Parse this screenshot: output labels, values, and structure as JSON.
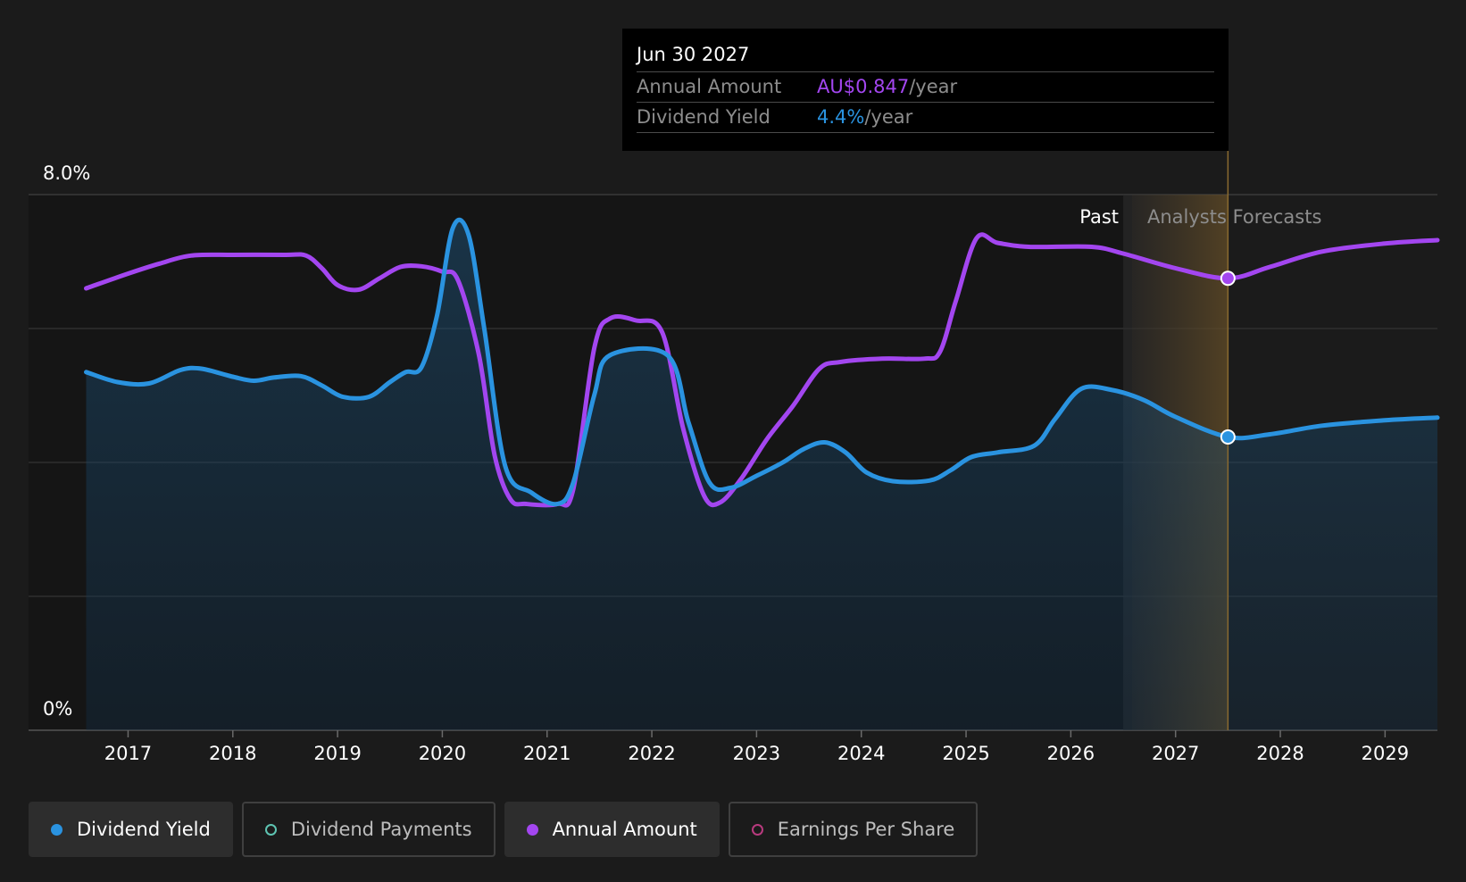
{
  "chart_data": {
    "type": "line",
    "y_axis": {
      "top_label": "8.0%",
      "bottom_label": "0%",
      "ylim": [
        0,
        8
      ]
    },
    "x_ticks": [
      "2017",
      "2018",
      "2019",
      "2020",
      "2021",
      "2022",
      "2023",
      "2024",
      "2025",
      "2026",
      "2027",
      "2028",
      "2029"
    ],
    "xlim": [
      2016.05,
      2029.5
    ],
    "past_label": "Past",
    "forecast_label": "Analysts Forecasts",
    "past_region_start": 2026.5,
    "forecast_divider": 2027.5,
    "series": [
      {
        "name": "Annual Amount",
        "color": "#a346f0",
        "points": [
          [
            2016.6,
            6.6
          ],
          [
            2017.0,
            6.82
          ],
          [
            2017.3,
            6.97
          ],
          [
            2017.6,
            7.09
          ],
          [
            2018.0,
            7.1
          ],
          [
            2018.5,
            7.1
          ],
          [
            2018.7,
            7.09
          ],
          [
            2018.85,
            6.9
          ],
          [
            2019.0,
            6.65
          ],
          [
            2019.2,
            6.58
          ],
          [
            2019.4,
            6.75
          ],
          [
            2019.6,
            6.92
          ],
          [
            2019.8,
            6.93
          ],
          [
            2020.0,
            6.85
          ],
          [
            2020.15,
            6.72
          ],
          [
            2020.35,
            5.6
          ],
          [
            2020.5,
            4.1
          ],
          [
            2020.65,
            3.45
          ],
          [
            2020.8,
            3.38
          ],
          [
            2021.1,
            3.38
          ],
          [
            2021.25,
            3.6
          ],
          [
            2021.45,
            5.7
          ],
          [
            2021.6,
            6.15
          ],
          [
            2021.85,
            6.12
          ],
          [
            2022.1,
            5.94
          ],
          [
            2022.3,
            4.5
          ],
          [
            2022.5,
            3.5
          ],
          [
            2022.65,
            3.4
          ],
          [
            2022.85,
            3.75
          ],
          [
            2023.1,
            4.35
          ],
          [
            2023.35,
            4.85
          ],
          [
            2023.6,
            5.4
          ],
          [
            2023.8,
            5.5
          ],
          [
            2024.2,
            5.55
          ],
          [
            2024.6,
            5.55
          ],
          [
            2024.75,
            5.65
          ],
          [
            2024.9,
            6.4
          ],
          [
            2025.1,
            7.35
          ],
          [
            2025.3,
            7.28
          ],
          [
            2025.6,
            7.22
          ],
          [
            2026.2,
            7.22
          ],
          [
            2026.5,
            7.12
          ],
          [
            2027.0,
            6.9
          ],
          [
            2027.5,
            6.75
          ],
          [
            2027.9,
            6.92
          ],
          [
            2028.4,
            7.15
          ],
          [
            2029.0,
            7.27
          ],
          [
            2029.5,
            7.32
          ]
        ]
      },
      {
        "name": "Dividend Yield",
        "color": "#2a93e0",
        "points": [
          [
            2016.6,
            5.35
          ],
          [
            2016.9,
            5.2
          ],
          [
            2017.2,
            5.18
          ],
          [
            2017.5,
            5.38
          ],
          [
            2017.7,
            5.4
          ],
          [
            2018.0,
            5.28
          ],
          [
            2018.2,
            5.22
          ],
          [
            2018.4,
            5.27
          ],
          [
            2018.65,
            5.29
          ],
          [
            2018.85,
            5.15
          ],
          [
            2019.05,
            4.98
          ],
          [
            2019.3,
            4.98
          ],
          [
            2019.5,
            5.2
          ],
          [
            2019.65,
            5.35
          ],
          [
            2019.8,
            5.42
          ],
          [
            2019.95,
            6.2
          ],
          [
            2020.1,
            7.5
          ],
          [
            2020.25,
            7.4
          ],
          [
            2020.4,
            6.0
          ],
          [
            2020.6,
            3.95
          ],
          [
            2020.85,
            3.55
          ],
          [
            2021.1,
            3.38
          ],
          [
            2021.25,
            3.7
          ],
          [
            2021.45,
            5.0
          ],
          [
            2021.6,
            5.6
          ],
          [
            2022.15,
            5.6
          ],
          [
            2022.35,
            4.6
          ],
          [
            2022.55,
            3.7
          ],
          [
            2022.75,
            3.62
          ],
          [
            2023.0,
            3.8
          ],
          [
            2023.25,
            4.0
          ],
          [
            2023.45,
            4.2
          ],
          [
            2023.65,
            4.3
          ],
          [
            2023.85,
            4.15
          ],
          [
            2024.05,
            3.85
          ],
          [
            2024.3,
            3.72
          ],
          [
            2024.65,
            3.73
          ],
          [
            2024.85,
            3.88
          ],
          [
            2025.05,
            4.08
          ],
          [
            2025.3,
            4.15
          ],
          [
            2025.65,
            4.25
          ],
          [
            2025.85,
            4.65
          ],
          [
            2026.1,
            5.1
          ],
          [
            2026.4,
            5.08
          ],
          [
            2026.7,
            4.93
          ],
          [
            2027.0,
            4.68
          ],
          [
            2027.5,
            4.38
          ],
          [
            2027.9,
            4.42
          ],
          [
            2028.4,
            4.55
          ],
          [
            2029.0,
            4.63
          ],
          [
            2029.5,
            4.67
          ]
        ]
      }
    ],
    "highlight": {
      "x": 2027.5,
      "values": {
        "Annual Amount": 6.75,
        "Dividend Yield": 4.38
      }
    }
  },
  "tooltip": {
    "date": "Jun 30 2027",
    "rows": [
      {
        "label": "Annual Amount",
        "value": "AU$0.847",
        "unit": "/year",
        "color": "#a346f0"
      },
      {
        "label": "Dividend Yield",
        "value": "4.4%",
        "unit": "/year",
        "color": "#2a93e0"
      }
    ]
  },
  "legend": [
    {
      "label": "Dividend Yield",
      "active": true,
      "dot": "filled",
      "color": "#2a93e0"
    },
    {
      "label": "Dividend Payments",
      "active": false,
      "dot": "outline",
      "color": "#5ec4b2"
    },
    {
      "label": "Annual Amount",
      "active": true,
      "dot": "filled",
      "color": "#a346f0"
    },
    {
      "label": "Earnings Per Share",
      "active": false,
      "dot": "outline",
      "color": "#b83a7e"
    }
  ]
}
